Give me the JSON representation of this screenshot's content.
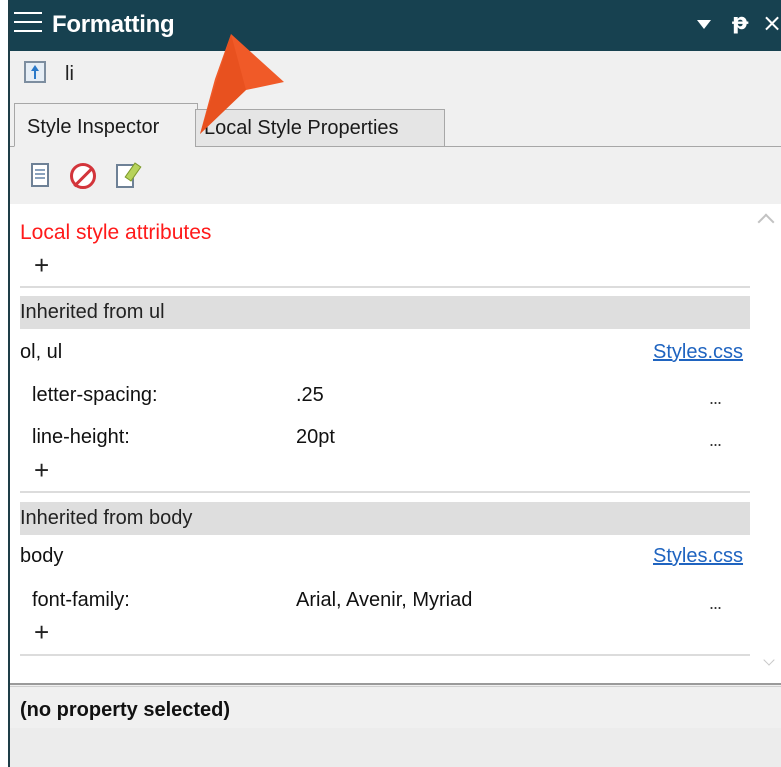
{
  "titlebar": {
    "title": "Formatting",
    "menu_icon": "hamburger-icon",
    "dropdown_icon": "dropdown-arrow-icon",
    "pin_icon": "pin-icon",
    "pin_glyph": "ᵽ",
    "close_icon": "close-icon",
    "close_glyph": "×",
    "background_color": "#174150"
  },
  "element": {
    "icon": "go-to-parent-icon",
    "name": "li"
  },
  "tabs": [
    {
      "label": "Style Inspector",
      "active": true
    },
    {
      "label": "Local Style Properties",
      "active": false
    }
  ],
  "toolbar": {
    "icons": [
      "document-icon",
      "remove-style-icon",
      "edit-style-icon"
    ]
  },
  "inspector": {
    "local_label": "Local style attributes",
    "local_label_color": "#ff1a1a",
    "plus_glyph": "+",
    "ellipsis_glyph": "...",
    "sections": [
      {
        "header": "Inherited from ul",
        "selector": "ol, ul",
        "source": "Styles.css",
        "properties": [
          {
            "name": "letter-spacing:",
            "value": ".25"
          },
          {
            "name": "line-height:",
            "value": "20pt"
          }
        ]
      },
      {
        "header": "Inherited from body",
        "selector": "body",
        "source": "Styles.css",
        "properties": [
          {
            "name": "font-family:",
            "value": "Arial, Avenir, Myriad"
          }
        ]
      }
    ]
  },
  "status": {
    "text": "(no property selected)"
  },
  "annotation": {
    "pointer_icon": "orange-pointer-arrow",
    "color": "#f05a28"
  }
}
